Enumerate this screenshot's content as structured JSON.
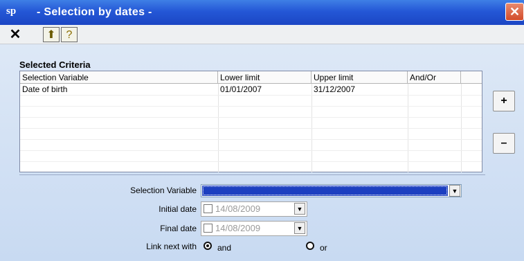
{
  "window": {
    "icon_text": "sp",
    "title": "- Selection by dates -",
    "close_glyph": "✕"
  },
  "toolbar": {
    "close_glyph": "✕",
    "folder_glyph": "⬆",
    "help_glyph": "?"
  },
  "criteria": {
    "heading": "Selected Criteria",
    "columns": [
      "Selection Variable",
      "Lower limit",
      "Upper limit",
      "And/Or"
    ],
    "rows": [
      [
        "Date of birth",
        "01/01/2007",
        "31/12/2007",
        ""
      ]
    ],
    "add_label": "+",
    "remove_label": "–"
  },
  "form": {
    "selection_variable_label": "Selection Variable",
    "selection_variable_value": "",
    "initial_date_label": "Initial date",
    "initial_date_value": "14/08/2009",
    "final_date_label": "Final date",
    "final_date_value": "14/08/2009",
    "link_label": "Link next with",
    "link_options": [
      "and",
      "or"
    ],
    "link_selected": "and"
  },
  "icons": {
    "dropdown": "chevron-down-icon",
    "close": "close-icon",
    "folder_up": "folder-up-icon",
    "help": "help-icon"
  }
}
